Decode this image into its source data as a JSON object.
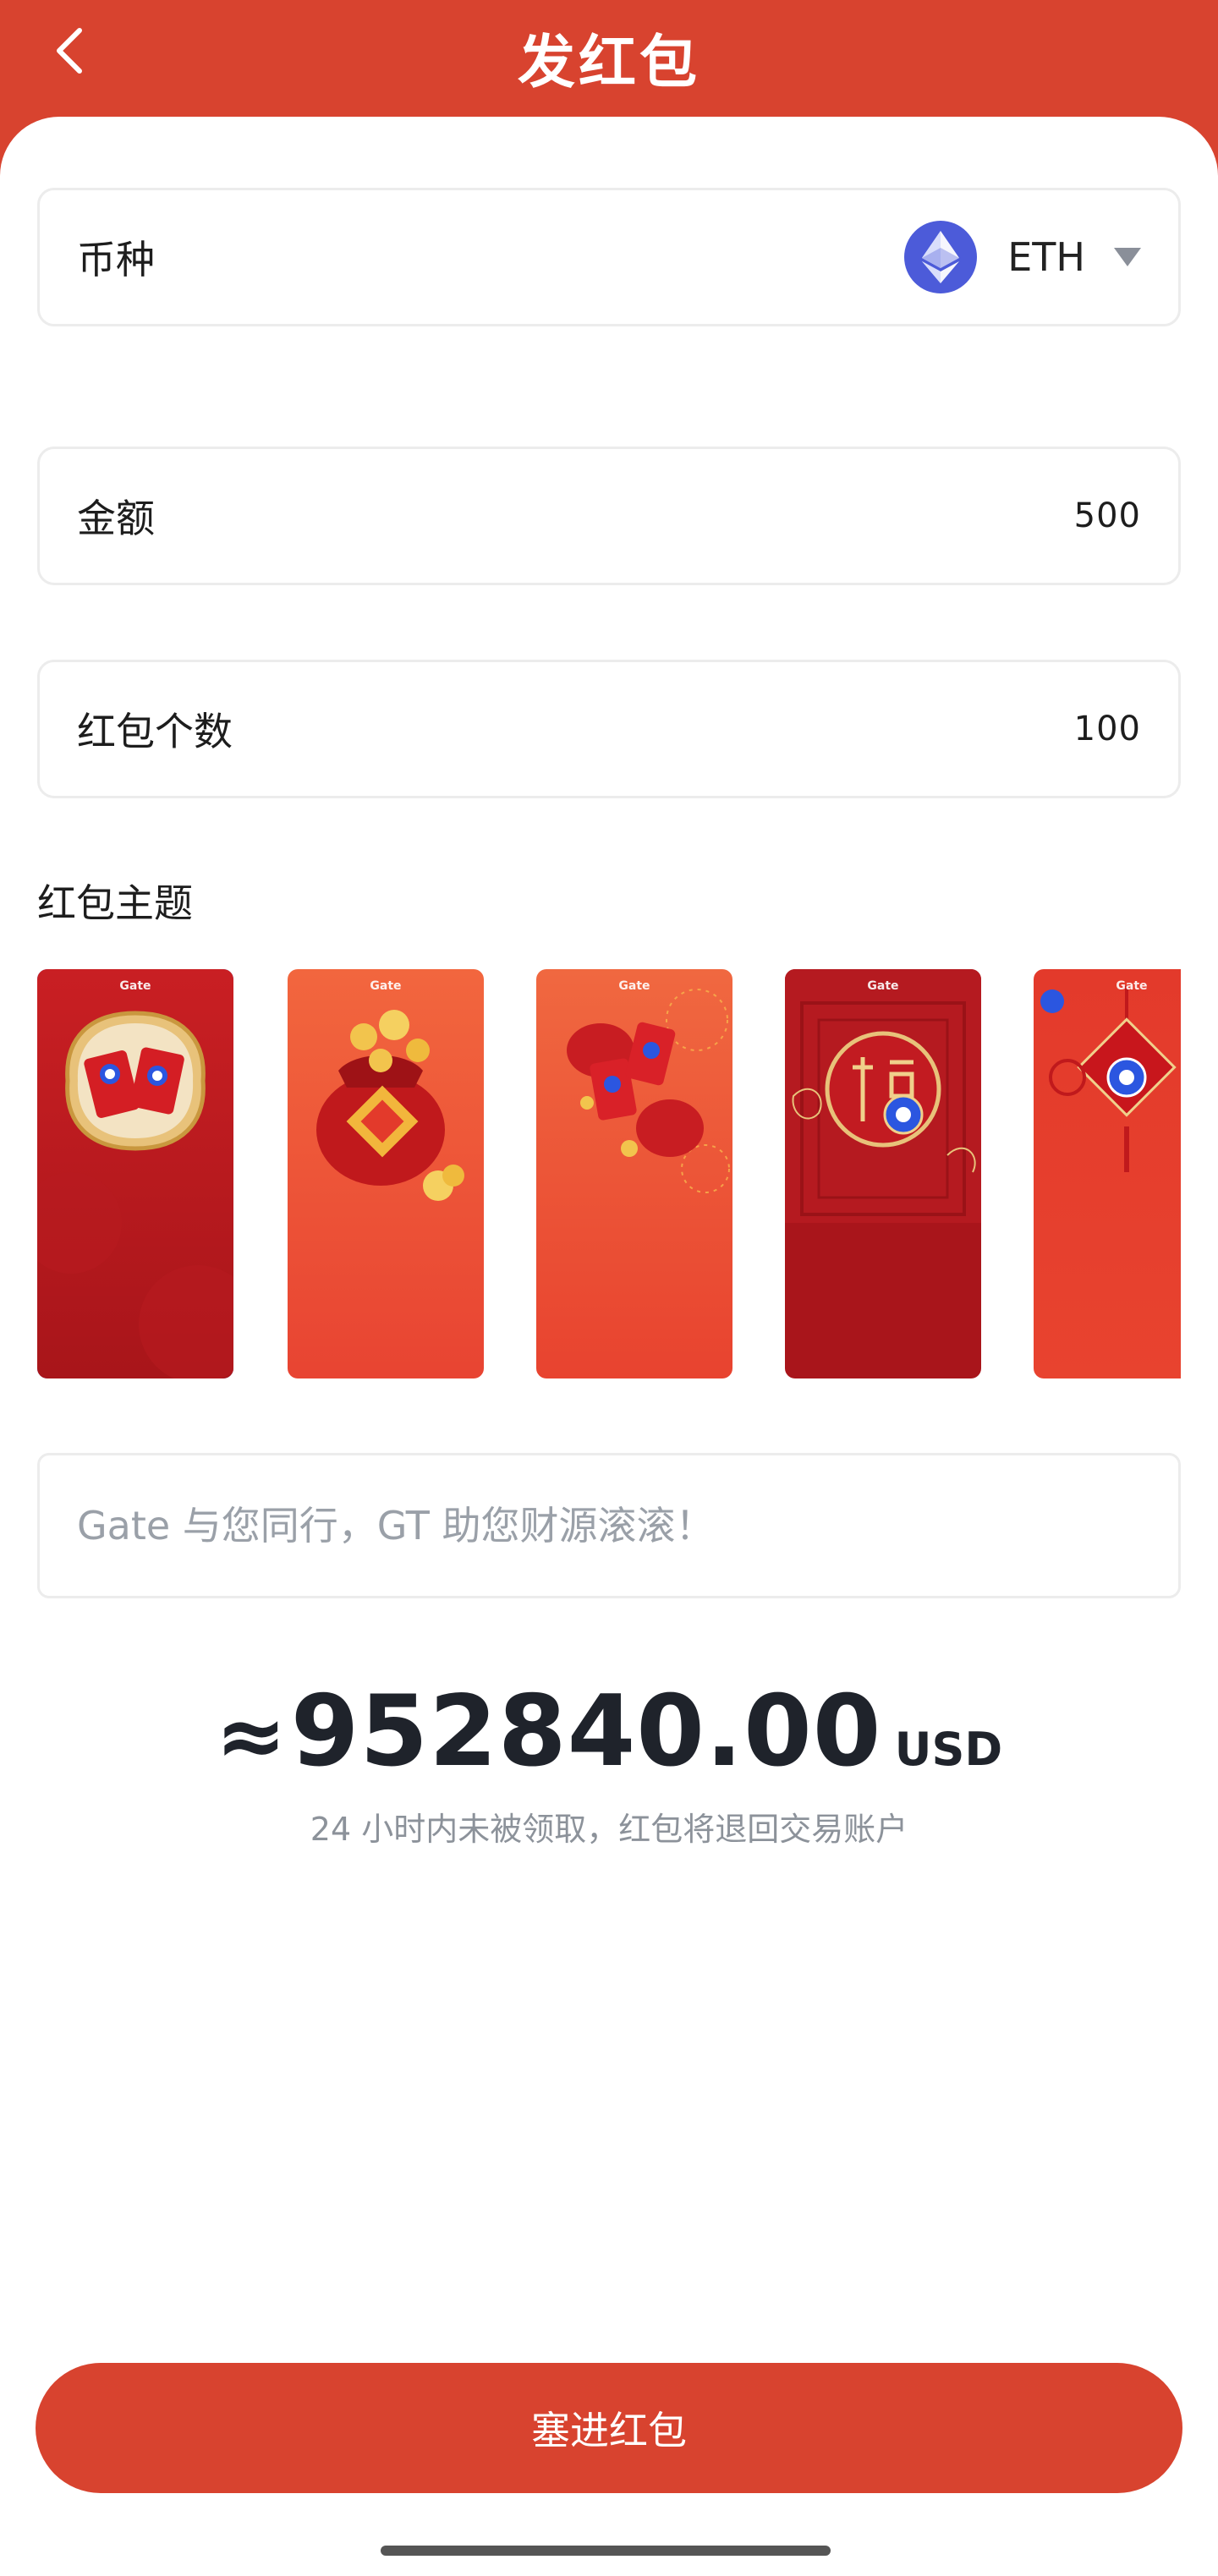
{
  "header": {
    "title": "发红包"
  },
  "coin": {
    "label": "币种",
    "value": "ETH"
  },
  "amount": {
    "label": "金额",
    "value": "500"
  },
  "count": {
    "label": "红包个数",
    "value": "100"
  },
  "themes": {
    "title": "红包主题",
    "brand": "Gate",
    "items": [
      {
        "name": "red-envelopes",
        "selected": true
      },
      {
        "name": "lucky-bag",
        "selected": false
      },
      {
        "name": "lanterns",
        "selected": false
      },
      {
        "name": "fu-blessing",
        "selected": false
      },
      {
        "name": "chinese-knot",
        "selected": false
      }
    ]
  },
  "message": {
    "placeholder": "Gate 与您同行，GT 助您财源滚滚！",
    "value": ""
  },
  "total": {
    "approx": "≈",
    "amount": "952840.00",
    "unit": "USD"
  },
  "note": "24 小时内未被领取，红包将退回交易账户",
  "submit": {
    "label": "塞进红包"
  },
  "colors": {
    "brand": "#d8432f",
    "selected": "#4d7ff0",
    "eth": "#4c5bd9"
  }
}
